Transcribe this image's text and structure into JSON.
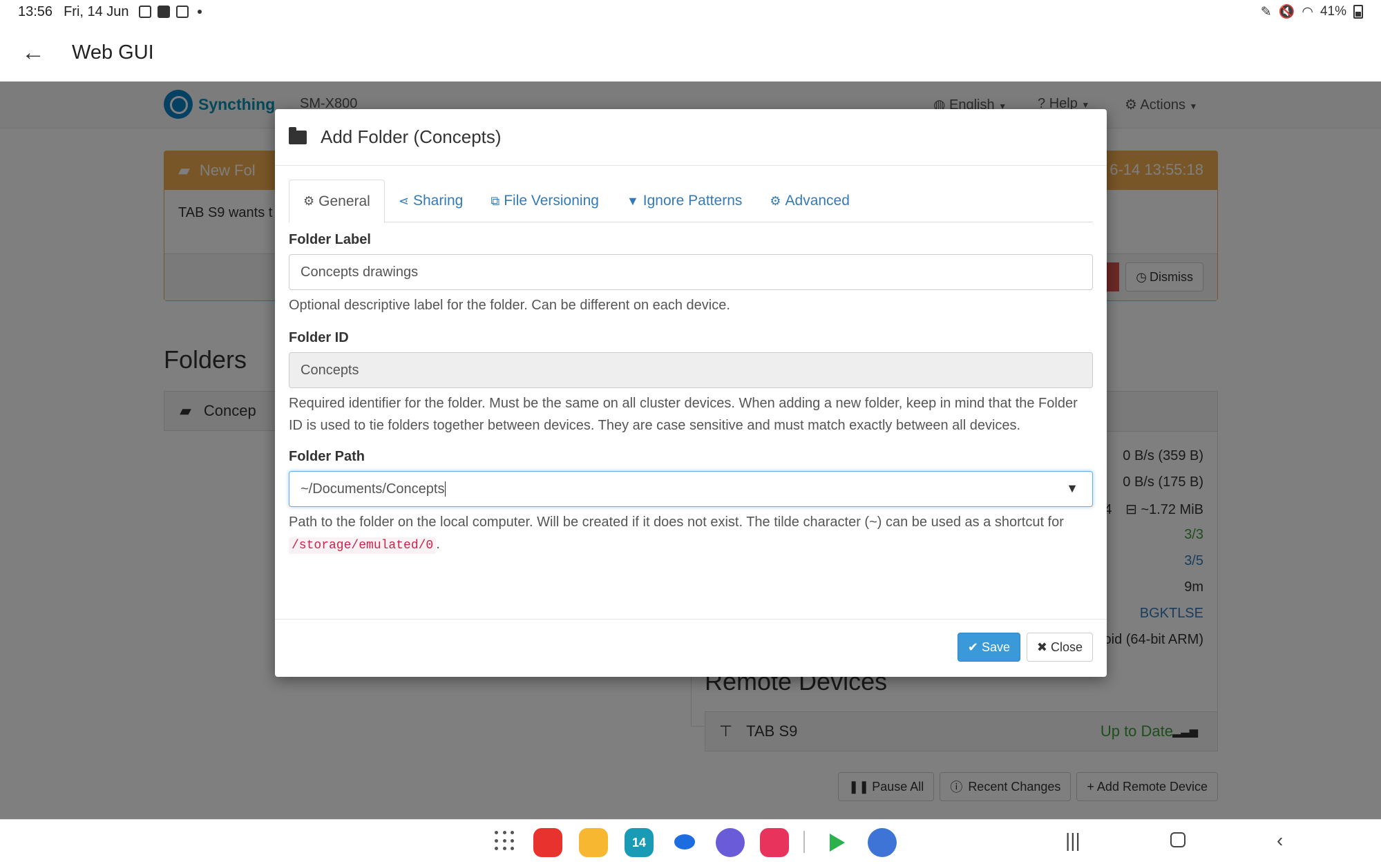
{
  "status": {
    "time": "13:56",
    "date": "Fri, 14 Jun",
    "battery": "41%"
  },
  "appbar": {
    "title": "Web GUI"
  },
  "syncthing": {
    "brand": "Syncthing",
    "device": "SM-X800",
    "nav": {
      "language": "English",
      "help": "Help",
      "actions": "Actions"
    },
    "notice": {
      "title": "New Fol",
      "timestamp": "6-14 13:55:18",
      "body": "TAB S9 wants t",
      "dismiss": "Dismiss"
    },
    "folders_heading": "Folders",
    "folder_name": "Concep",
    "device_stats": {
      "download": "0 B/s (359 B)",
      "upload": "0 B/s (175 B)",
      "local_state_prefix": "4",
      "local_state": "~1.72 MiB",
      "listeners": "3/3",
      "discovery": "3/5",
      "uptime": "9m",
      "identification": "BGKTLSE",
      "version": "oid (64-bit ARM)"
    },
    "remote_heading": "Remote Devices",
    "remote_device": {
      "name": "TAB S9",
      "status": "Up to Date"
    },
    "buttons": {
      "pause_all": "Pause All",
      "recent_changes": "Recent Changes",
      "add_remote": "Add Remote Device"
    }
  },
  "modal": {
    "title": "Add Folder (Concepts)",
    "tabs": [
      {
        "label": "General",
        "icon": "gear-icon"
      },
      {
        "label": "Sharing",
        "icon": "share-icon"
      },
      {
        "label": "File Versioning",
        "icon": "copy-icon"
      },
      {
        "label": "Ignore Patterns",
        "icon": "filter-icon"
      },
      {
        "label": "Advanced",
        "icon": "gears-icon"
      }
    ],
    "folder_label": {
      "label": "Folder Label",
      "value": "Concepts drawings",
      "help": "Optional descriptive label for the folder. Can be different on each device."
    },
    "folder_id": {
      "label": "Folder ID",
      "value": "Concepts",
      "help": "Required identifier for the folder. Must be the same on all cluster devices. When adding a new folder, keep in mind that the Folder ID is used to tie folders together between devices. They are case sensitive and must match exactly between all devices."
    },
    "folder_path": {
      "label": "Folder Path",
      "value": "~/Documents/Concepts",
      "help_before": "Path to the folder on the local computer. Will be created if it does not exist. The tilde character (~) can be used as a shortcut for",
      "help_code": "/storage/emulated/0",
      "help_after": "."
    },
    "save_label": "Save",
    "close_label": "Close",
    "accent": "#3a9ad9"
  },
  "taskbar": {
    "calendar_day": "14",
    "apps": [
      "app-drawer-icon",
      "app-red-icon",
      "files-icon",
      "calendar-icon",
      "messages-icon",
      "internet-icon",
      "screen-recorder-icon",
      "play-store-icon",
      "cloud-icon"
    ]
  }
}
